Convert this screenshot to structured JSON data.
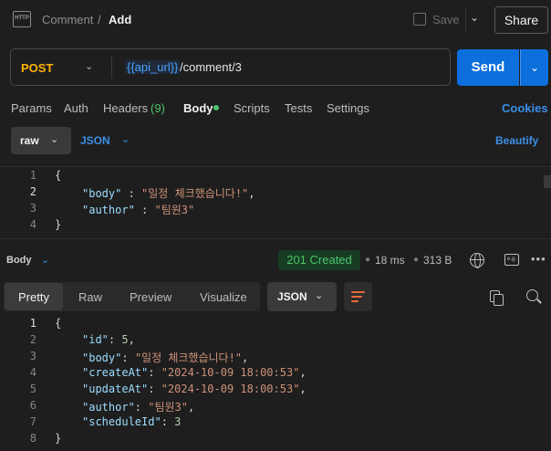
{
  "header": {
    "icon_text": "HTTP",
    "breadcrumb_parent": "Comment",
    "breadcrumb_sep": "/",
    "breadcrumb_current": "Add",
    "save_label": "Save",
    "share_label": "Share"
  },
  "request": {
    "method": "POST",
    "url_variable": "{{api_url}}",
    "url_path": "/comment/3",
    "send_label": "Send"
  },
  "tabs": {
    "params": "Params",
    "auth": "Auth",
    "headers": "Headers",
    "headers_count": "(9)",
    "body": "Body",
    "scripts": "Scripts",
    "tests": "Tests",
    "settings": "Settings",
    "cookies": "Cookies"
  },
  "body_toolbar": {
    "mode": "raw",
    "format": "JSON",
    "beautify": "Beautify"
  },
  "request_body": {
    "line_numbers": [
      "1",
      "2",
      "3",
      "4"
    ],
    "open_brace": "{",
    "close_brace": "}",
    "fields": [
      {
        "key": "\"body\"",
        "sep": " : ",
        "value": "\"일정 체크했습니다!\"",
        "trail": ","
      },
      {
        "key": "\"author\"",
        "sep": " : ",
        "value": "\"팀원3\"",
        "trail": ""
      }
    ]
  },
  "response": {
    "section_label": "Body",
    "status": "201 Created",
    "time": "18 ms",
    "size": "313 B",
    "eg_icon_text": "e.g.",
    "view_tabs": [
      "Pretty",
      "Raw",
      "Preview",
      "Visualize"
    ],
    "format": "JSON",
    "line_numbers": [
      "1",
      "2",
      "3",
      "4",
      "5",
      "6",
      "7",
      "8"
    ],
    "open_brace": "{",
    "close_brace": "}",
    "fields": [
      {
        "key": "\"id\"",
        "sep": ": ",
        "value": "5",
        "trail": ",",
        "type": "number"
      },
      {
        "key": "\"body\"",
        "sep": ": ",
        "value": "\"일정 체크했습니다!\"",
        "trail": ",",
        "type": "string"
      },
      {
        "key": "\"createAt\"",
        "sep": ": ",
        "value": "\"2024-10-09 18:00:53\"",
        "trail": ",",
        "type": "string"
      },
      {
        "key": "\"updateAt\"",
        "sep": ": ",
        "value": "\"2024-10-09 18:00:53\"",
        "trail": ",",
        "type": "string"
      },
      {
        "key": "\"author\"",
        "sep": ": ",
        "value": "\"팀원3\"",
        "trail": ",",
        "type": "string"
      },
      {
        "key": "\"scheduleId\"",
        "sep": ": ",
        "value": "3",
        "trail": "",
        "type": "number"
      }
    ]
  },
  "colors": {
    "accent": "#0c6fdc",
    "link": "#3b8fe8",
    "method": "#ffb400",
    "success": "#4cc46b",
    "json_key": "#9cdcfe",
    "json_string": "#ce9178",
    "json_number": "#b5cea8"
  }
}
